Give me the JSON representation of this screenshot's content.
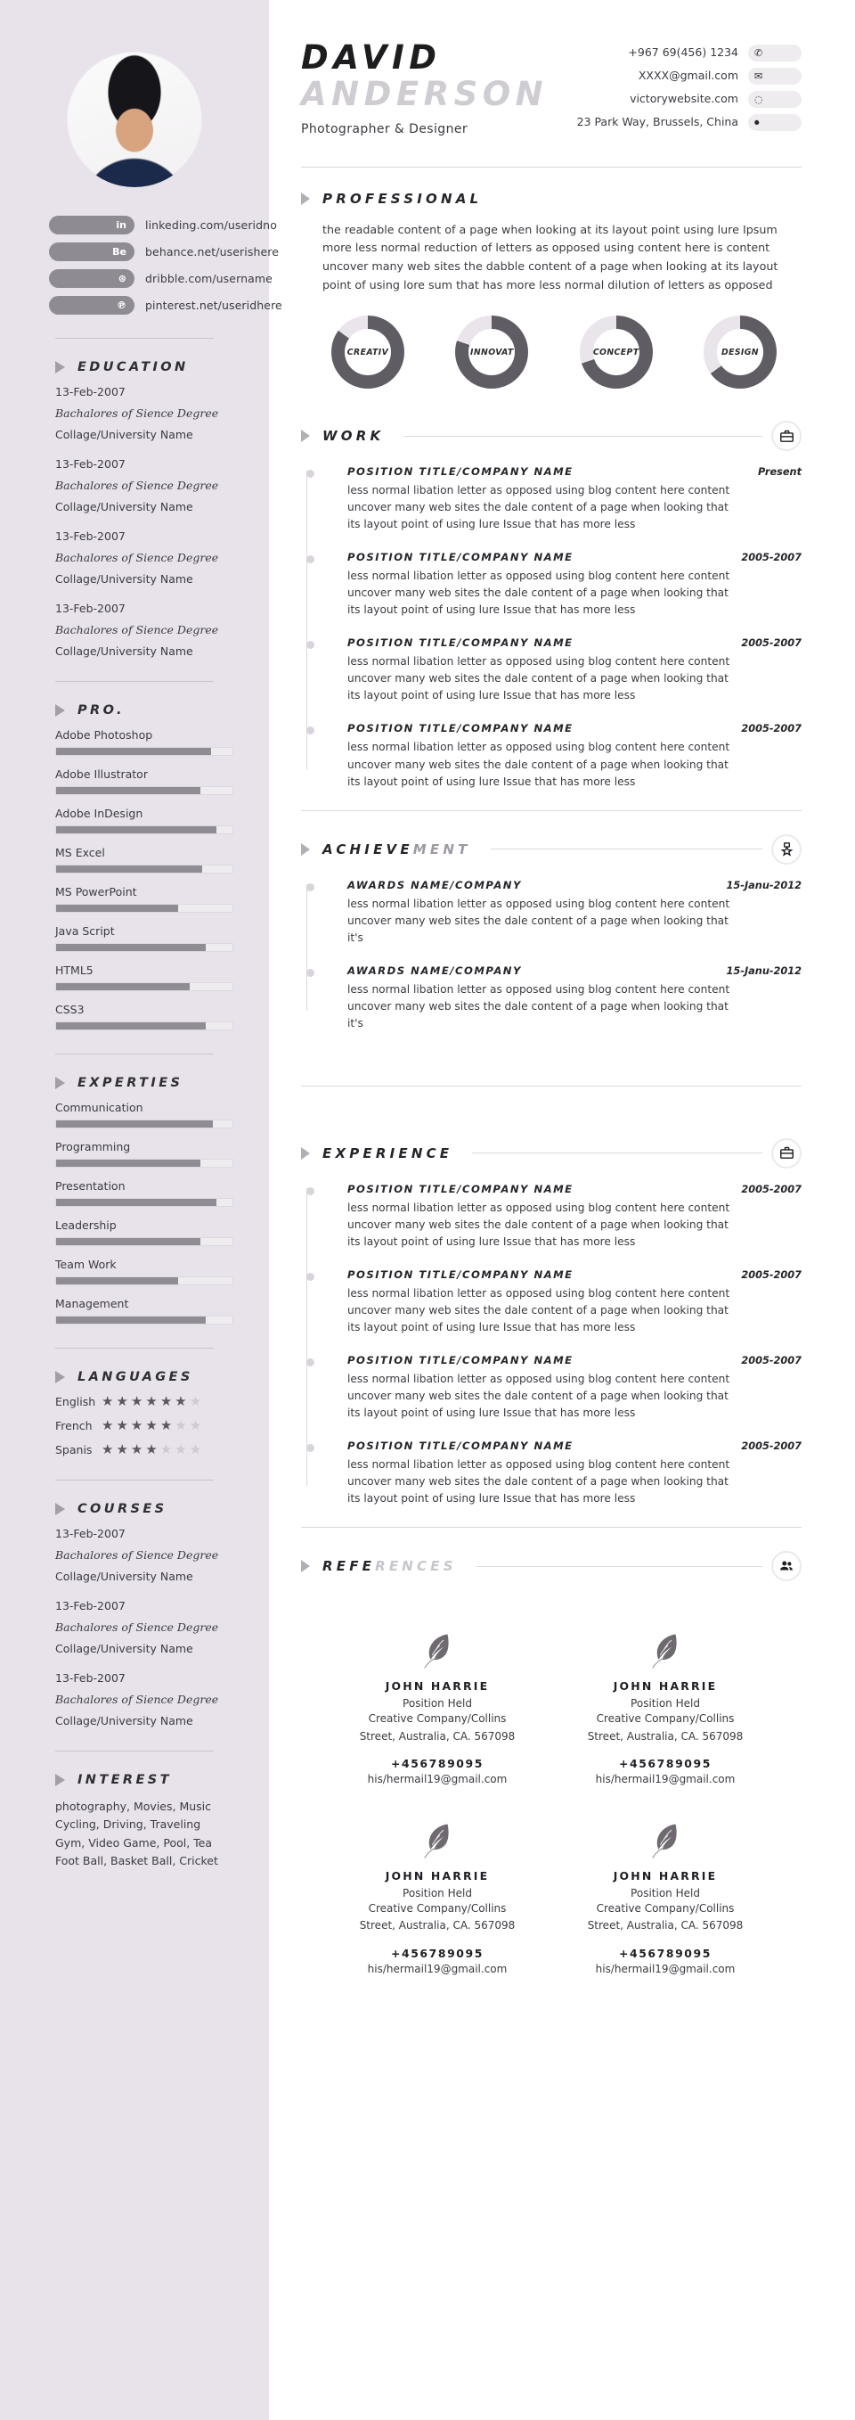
{
  "header": {
    "first_name": "DAVID",
    "last_name": "ANDERSON",
    "job_title": "Photographer & Designer",
    "contacts": [
      {
        "text": "+967 69(456) 1234",
        "icon": "phone-icon",
        "glyph": "✆"
      },
      {
        "text": "XXXX@gmail.com",
        "icon": "envelope-icon",
        "glyph": "✉"
      },
      {
        "text": "victorywebsite.com",
        "icon": "globe-icon",
        "glyph": "◌"
      },
      {
        "text": "23 Park Way, Brussels, China",
        "icon": "location-pin-icon",
        "glyph": "⏺"
      }
    ]
  },
  "sidebar": {
    "social": [
      {
        "icon": "linkedin-icon",
        "glyph": "in",
        "url": "linkeding.com/useridno"
      },
      {
        "icon": "behance-icon",
        "glyph": "Be",
        "url": "behance.net/userishere"
      },
      {
        "icon": "dribbble-icon",
        "glyph": "⊛",
        "url": "dribble.com/username"
      },
      {
        "icon": "pinterest-icon",
        "glyph": "℗",
        "url": "pinterest.net/useridhere"
      }
    ],
    "education": {
      "title": "EDUCATION",
      "items": [
        {
          "date": "13-Feb-2007",
          "degree": "Bachalores of Sience Degree",
          "school": "Collage/University Name"
        },
        {
          "date": "13-Feb-2007",
          "degree": "Bachalores of Sience Degree",
          "school": "Collage/University Name"
        },
        {
          "date": "13-Feb-2007",
          "degree": "Bachalores of Sience Degree",
          "school": "Collage/University Name"
        },
        {
          "date": "13-Feb-2007",
          "degree": "Bachalores of Sience Degree",
          "school": "Collage/University Name"
        }
      ]
    },
    "pro": {
      "title": "PRO.",
      "items": [
        {
          "label": "Adobe Photoshop",
          "value": 88
        },
        {
          "label": "Adobe Illustrator",
          "value": 82
        },
        {
          "label": "Adobe InDesign",
          "value": 91
        },
        {
          "label": "MS Excel",
          "value": 83
        },
        {
          "label": "MS PowerPoint",
          "value": 69
        },
        {
          "label": "Java Script",
          "value": 85
        },
        {
          "label": "HTML5",
          "value": 76
        },
        {
          "label": "CSS3",
          "value": 85
        }
      ]
    },
    "experties": {
      "title": "EXPERTIES",
      "items": [
        {
          "label": "Communication",
          "value": 89
        },
        {
          "label": "Programming",
          "value": 82
        },
        {
          "label": "Presentation",
          "value": 91
        },
        {
          "label": "Leadership",
          "value": 82
        },
        {
          "label": "Team Work",
          "value": 69
        },
        {
          "label": "Management",
          "value": 85
        }
      ]
    },
    "languages": {
      "title": "LANGUAGES",
      "max_stars": 7,
      "items": [
        {
          "label": "English",
          "stars": 6
        },
        {
          "label": "French",
          "stars": 5
        },
        {
          "label": "Spanis",
          "stars": 4
        }
      ]
    },
    "courses": {
      "title": "COURSES",
      "items": [
        {
          "date": "13-Feb-2007",
          "degree": "Bachalores of Sience Degree",
          "school": "Collage/University Name"
        },
        {
          "date": "13-Feb-2007",
          "degree": "Bachalores of Sience Degree",
          "school": "Collage/University Name"
        },
        {
          "date": "13-Feb-2007",
          "degree": "Bachalores of Sience Degree",
          "school": "Collage/University Name"
        }
      ]
    },
    "interest": {
      "title": "INTEREST",
      "text": "photography, Movies, Music Cycling, Driving, Traveling Gym, Video Game, Pool, Tea Foot Ball, Basket Ball, Cricket"
    }
  },
  "main": {
    "professional": {
      "title": "PROFESSIONAL",
      "text": "the readable content of a page when looking at its layout point using lure Ipsum more less normal reduction of letters as opposed using content here is content uncover many web sites the dabble content of a page when looking at its layout point of using lore sum that has more less normal dilution of letters as opposed"
    },
    "donuts": [
      {
        "label": "CREATIV",
        "value": 85
      },
      {
        "label": "INNOVAT",
        "value": 80
      },
      {
        "label": "CONCEPT",
        "value": 70
      },
      {
        "label": "DESIGN",
        "value": 65
      }
    ],
    "work": {
      "title": "WORK",
      "icon": "briefcase-icon",
      "items": [
        {
          "title": "POSITION TITLE/COMPANY NAME",
          "date": "Present",
          "desc": "less normal libation letter as opposed using blog content here content uncover many web sites the dale content of a page when looking that its layout point of using lure Issue that has more less"
        },
        {
          "title": "POSITION TITLE/COMPANY NAME",
          "date": "2005-2007",
          "desc": "less normal libation letter as opposed using blog content here content uncover many web sites the dale content of a page when looking that its layout point of using lure Issue that has more less"
        },
        {
          "title": "POSITION TITLE/COMPANY NAME",
          "date": "2005-2007",
          "desc": "less normal libation letter as opposed using blog content here content uncover many web sites the dale content of a page when looking that its layout point of using lure Issue that has more less"
        },
        {
          "title": "POSITION TITLE/COMPANY NAME",
          "date": "2005-2007",
          "desc": "less normal libation letter as opposed using blog content here content uncover many web sites the dale content of a page when looking that its layout point of using lure Issue that has more less"
        }
      ]
    },
    "achievement": {
      "title_solid": "ACHIEVE",
      "title_fade": "MENT",
      "icon": "medal-icon",
      "items": [
        {
          "title": "AWARDS NAME/COMPANY",
          "date": "15-Janu-2012",
          "desc": "less normal libation letter as opposed using blog content here content uncover many web sites the dale content of a page when looking that it's"
        },
        {
          "title": "AWARDS NAME/COMPANY",
          "date": "15-Janu-2012",
          "desc": "less normal libation letter as opposed using blog content here content uncover many web sites the dale content of a page when looking that it's"
        }
      ]
    },
    "experience": {
      "title": "EXPERIENCE",
      "icon": "briefcase-icon",
      "items": [
        {
          "title": "POSITION TITLE/COMPANY NAME",
          "date": "2005-2007",
          "desc": "less normal libation letter as opposed using blog content here content uncover many web sites the dale content of a page when looking that its layout point of using lure Issue that has more less"
        },
        {
          "title": "POSITION TITLE/COMPANY NAME",
          "date": "2005-2007",
          "desc": "less normal libation letter as opposed using blog content here content uncover many web sites the dale content of a page when looking that its layout point of using lure Issue that has more less"
        },
        {
          "title": "POSITION TITLE/COMPANY NAME",
          "date": "2005-2007",
          "desc": "less normal libation letter as opposed using blog content here content uncover many web sites the dale content of a page when looking that its layout point of using lure Issue that has more less"
        },
        {
          "title": "POSITION TITLE/COMPANY NAME",
          "date": "2005-2007",
          "desc": "less normal libation letter as opposed using blog content here content uncover many web sites the dale content of a page when looking that its layout point of using lure Issue that has more less"
        }
      ]
    },
    "references": {
      "title_solid": "REFE",
      "title_fade": "RENCES",
      "icon": "people-icon",
      "items": [
        {
          "name": "JOHN HARRIE",
          "position": "Position Held",
          "address_1": "Creative Company/Collins",
          "address_2": "Street, Australia, CA. 567098",
          "phone": "+456789095",
          "email": "his/hermail19@gmail.com"
        },
        {
          "name": "JOHN HARRIE",
          "position": "Position Held",
          "address_1": "Creative Company/Collins",
          "address_2": "Street, Australia, CA. 567098",
          "phone": "+456789095",
          "email": "his/hermail19@gmail.com"
        },
        {
          "name": "JOHN HARRIE",
          "position": "Position Held",
          "address_1": "Creative Company/Collins",
          "address_2": "Street, Australia, CA. 567098",
          "phone": "+456789095",
          "email": "his/hermail19@gmail.com"
        },
        {
          "name": "JOHN HARRIE",
          "position": "Position Held",
          "address_1": "Creative Company/Collins",
          "address_2": "Street, Australia, CA. 567098",
          "phone": "+456789095",
          "email": "his/hermail19@gmail.com"
        }
      ]
    }
  },
  "colors": {
    "sidebar_bg": "#e8e3ea",
    "accent_gray": "#8f8b93",
    "bar_fill": "#908c94",
    "bar_track": "#efecf0",
    "text": "#3b3a40"
  }
}
